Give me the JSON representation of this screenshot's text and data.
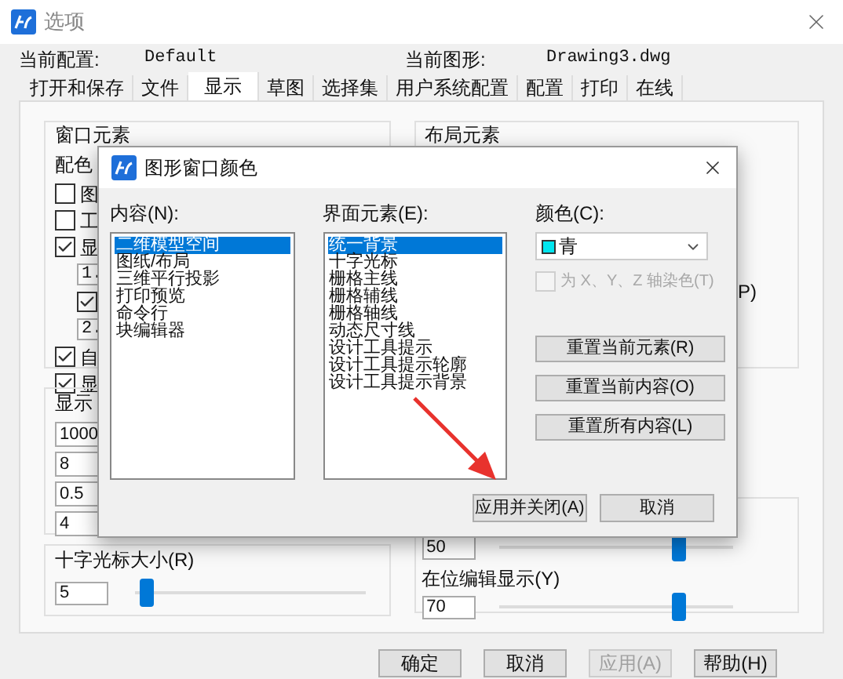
{
  "window": {
    "title": "选项"
  },
  "profile": {
    "label": "当前配置:",
    "value": "Default"
  },
  "drawing": {
    "label": "当前图形:",
    "value": "Drawing3.dwg"
  },
  "tabs": [
    {
      "label": "打开和保存",
      "selected": false
    },
    {
      "label": "文件",
      "selected": false
    },
    {
      "label": "显示",
      "selected": true
    },
    {
      "label": "草图",
      "selected": false
    },
    {
      "label": "选择集",
      "selected": false
    },
    {
      "label": "用户系统配置",
      "selected": false
    },
    {
      "label": "配置",
      "selected": false
    },
    {
      "label": "打印",
      "selected": false
    },
    {
      "label": "在线",
      "selected": false
    }
  ],
  "window_elements": {
    "title": "窗口元素",
    "scheme_label": "配色",
    "options": [
      {
        "kind": "checkbox",
        "label": "图",
        "checked": false
      },
      {
        "kind": "checkbox",
        "label": "工",
        "checked": false
      },
      {
        "kind": "checkbox",
        "label": "显",
        "checked": true,
        "children": [
          {
            "kind": "field",
            "value": "1."
          },
          {
            "kind": "checkbox",
            "checked": true
          },
          {
            "kind": "field",
            "value": "2."
          }
        ]
      },
      {
        "kind": "checkbox",
        "label": "自",
        "checked": true
      },
      {
        "kind": "checkbox",
        "label": "显",
        "checked": true
      }
    ]
  },
  "layout_elements": {
    "title": "布局元素",
    "fragment": "P)"
  },
  "display_resolution": {
    "title": "显示",
    "fields": [
      "1000",
      "8",
      "0.5",
      "4"
    ]
  },
  "crosshair": {
    "title": "十字光标大小(R)",
    "value": "5",
    "level": 0.05
  },
  "fade_sliders": [
    {
      "value": "50",
      "level": 0.77
    },
    {
      "label": "在位编辑显示(Y)",
      "value": "70",
      "level": 0.77
    }
  ],
  "buttons": [
    {
      "label": "确定",
      "disabled": false
    },
    {
      "label": "取消",
      "disabled": false
    },
    {
      "label": "应用(A)",
      "disabled": true
    },
    {
      "label": "帮助(H)",
      "disabled": false
    }
  ],
  "dialog": {
    "title": "图形窗口颜色",
    "content_label": "内容(N):",
    "content_items": [
      {
        "label": "二维模型空间",
        "selected": true
      },
      {
        "label": "图纸/布局",
        "selected": false
      },
      {
        "label": "三维平行投影",
        "selected": false
      },
      {
        "label": "打印预览",
        "selected": false
      },
      {
        "label": "命令行",
        "selected": false
      },
      {
        "label": "块编辑器",
        "selected": false
      }
    ],
    "element_label": "界面元素(E):",
    "element_items": [
      {
        "label": "统一背景",
        "selected": true
      },
      {
        "label": "十字光标",
        "selected": false
      },
      {
        "label": "栅格主线",
        "selected": false
      },
      {
        "label": "栅格辅线",
        "selected": false
      },
      {
        "label": "栅格轴线",
        "selected": false
      },
      {
        "label": "动态尺寸线",
        "selected": false
      },
      {
        "label": "设计工具提示",
        "selected": false
      },
      {
        "label": "设计工具提示轮廓",
        "selected": false
      },
      {
        "label": "设计工具提示背景",
        "selected": false
      }
    ],
    "color_label": "颜色(C):",
    "color": {
      "name": "青",
      "color": "#00e5ee"
    },
    "tint": {
      "label": "为 X、Y、Z 轴染色(T)",
      "checked": false,
      "disabled": true
    },
    "reset_buttons": [
      "重置当前元素(R)",
      "重置当前内容(O)",
      "重置所有内容(L)"
    ],
    "buttons": [
      "应用并关闭(A)",
      "取消"
    ]
  }
}
